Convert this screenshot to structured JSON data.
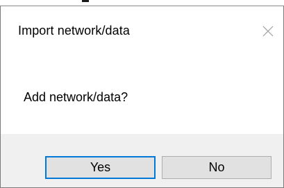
{
  "dialog": {
    "title": "Import network/data",
    "message": "Add network/data?",
    "close_icon": "close-icon"
  },
  "buttons": {
    "yes_label": "Yes",
    "no_label": "No"
  },
  "colors": {
    "footer_bg": "#f0f0f0",
    "button_bg": "#e1e1e1",
    "button_border": "#adadad",
    "focus_border": "#0078d7",
    "close_icon": "#a0a0a0"
  }
}
